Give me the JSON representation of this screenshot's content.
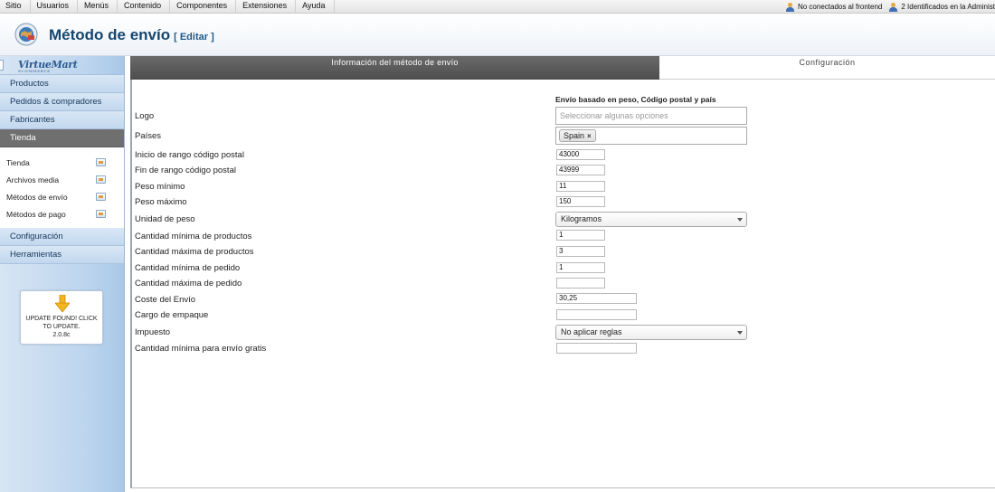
{
  "topbar": {
    "menu": [
      "Sitio",
      "Usuarios",
      "Menús",
      "Contenido",
      "Componentes",
      "Extensiones",
      "Ayuda"
    ],
    "status_frontend": "No conectados al frontend",
    "status_admin": "2 Identificados en la Administ"
  },
  "header": {
    "title": "Método de envío",
    "subtitle": "[ Editar ]"
  },
  "sidebar": {
    "logo_text": "VirtueMart",
    "logo_tagline": "ECOMMERCE",
    "sections_top": [
      "Productos",
      "Pedidos & compradores",
      "Fabricantes",
      "Tienda"
    ],
    "sub_items": [
      {
        "label": "Tienda",
        "icon": "store-icon"
      },
      {
        "label": "Archivos media",
        "icon": "media-icon"
      },
      {
        "label": "Métodos de envío",
        "icon": "truck-icon"
      },
      {
        "label": "Métodos de pago",
        "icon": "payment-icon"
      }
    ],
    "sections_bottom": [
      "Configuración",
      "Herramientas"
    ],
    "update_notice": "UPDATE FOUND! CLICK TO UPDATE.",
    "update_version": "2.0.8c",
    "active_section": "Tienda"
  },
  "tabs": {
    "info": "Información del método de envío",
    "config": "Configuración"
  },
  "form": {
    "section_heading": "Envío basado en peso, Código postal y país",
    "logo_label": "Logo",
    "logo_placeholder": "Seleccionar algunas opciones",
    "countries_label": "Países",
    "country_chip": "Spain",
    "fields": [
      {
        "label": "Inicio de rango código postal",
        "value": "43000"
      },
      {
        "label": "Fin de rango código postal",
        "value": "43999"
      },
      {
        "label": "Peso mínimo",
        "value": "11"
      },
      {
        "label": "Peso máximo",
        "value": "150"
      }
    ],
    "weight_unit_label": "Unidad de peso",
    "weight_unit_value": "Kilogramos",
    "fields2": [
      {
        "label": "Cantidad mínima de productos",
        "value": "1"
      },
      {
        "label": "Cantidad máxima de productos",
        "value": "3"
      },
      {
        "label": "Cantidad mínima de pedido",
        "value": "1"
      },
      {
        "label": "Cantidad máxima de pedido",
        "value": ""
      }
    ],
    "shipping_cost_label": "Coste del Envío",
    "shipping_cost_value": "30,25",
    "packaging_label": "Cargo de empaque",
    "packaging_value": "",
    "tax_label": "Impuesto",
    "tax_value": "No aplicar reglas",
    "free_shipping_label": "Cantidad mínima para envío gratis",
    "free_shipping_value": ""
  }
}
